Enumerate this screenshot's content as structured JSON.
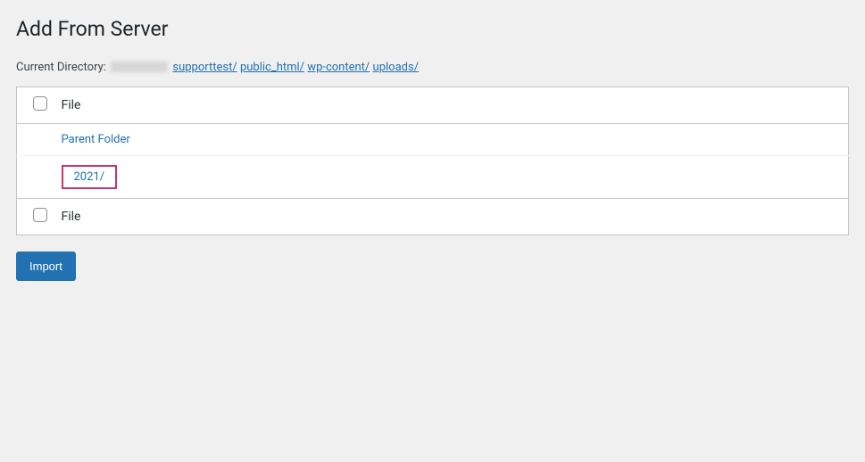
{
  "page": {
    "title": "Add From Server"
  },
  "directory": {
    "label": "Current Directory:",
    "path_segments": [
      {
        "label": "supporttest/"
      },
      {
        "label": "public_html/"
      },
      {
        "label": "wp-content/"
      },
      {
        "label": "uploads/"
      }
    ]
  },
  "table": {
    "header": {
      "file_column": "File"
    },
    "rows": [
      {
        "label": "Parent Folder",
        "highlighted": false
      },
      {
        "label": "2021/",
        "highlighted": true
      }
    ],
    "footer": {
      "file_column": "File"
    }
  },
  "actions": {
    "import_label": "Import"
  }
}
